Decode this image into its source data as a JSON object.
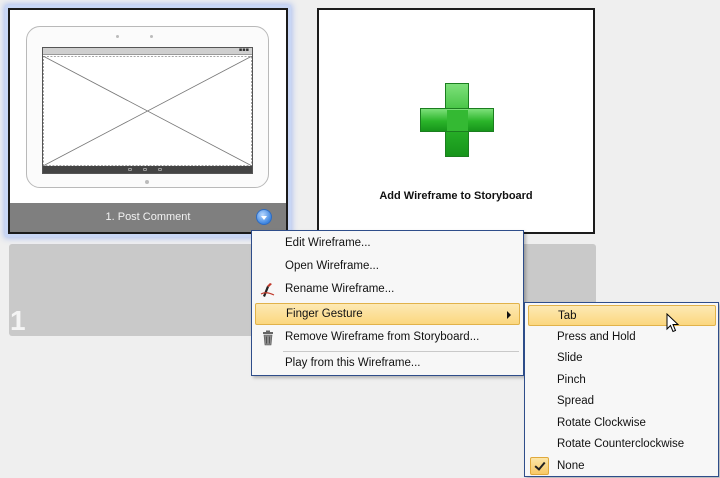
{
  "storyboard": {
    "frames": [
      {
        "label": "1. Post Comment"
      }
    ],
    "add_card": {
      "label": "Add Wireframe to Storyboard"
    },
    "row_number": "1"
  },
  "context_menu": {
    "items": [
      {
        "label": "Edit Wireframe...",
        "icon": ""
      },
      {
        "label": "Open Wireframe...",
        "icon": ""
      },
      {
        "label": "Rename Wireframe...",
        "icon": "rename-pen-icon"
      },
      {
        "label": "Finger Gesture",
        "icon": "",
        "submenu": true
      },
      {
        "label": "Remove Wireframe from Storyboard...",
        "icon": "trash-icon"
      },
      {
        "label": "Play from this Wireframe...",
        "icon": ""
      }
    ]
  },
  "gesture_submenu": {
    "items": [
      {
        "label": "Tab"
      },
      {
        "label": "Press and Hold"
      },
      {
        "label": "Slide"
      },
      {
        "label": "Pinch"
      },
      {
        "label": "Spread"
      },
      {
        "label": "Rotate Clockwise"
      },
      {
        "label": "Rotate Counterclockwise"
      },
      {
        "label": "None",
        "checked": true
      }
    ]
  },
  "colors": {
    "menu_highlight": "#fbd77f",
    "menu_border": "#2e4d8a",
    "frame_footer": "#7f7f7f",
    "plus_green": "#2bb52a"
  }
}
